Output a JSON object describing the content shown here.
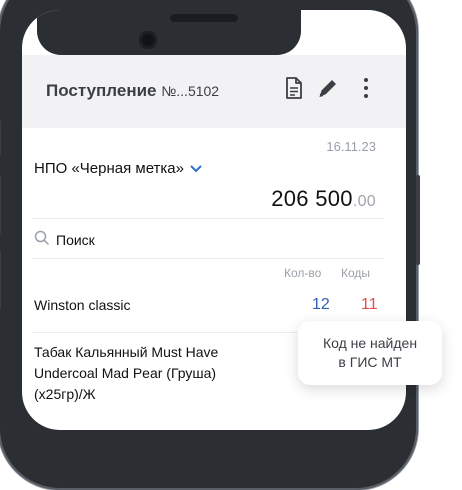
{
  "header": {
    "title": "Поступление",
    "number": "№...5102",
    "icons": [
      "document-icon",
      "pencil-icon",
      "more-vertical-icon"
    ]
  },
  "document": {
    "date": "16.11.23",
    "supplier": "НПО «Черная метка»",
    "amount_main": "206 500",
    "amount_cents": ".00"
  },
  "search": {
    "label": "Поиск"
  },
  "table": {
    "columns": [
      "Кол-во",
      "Коды"
    ],
    "rows": [
      {
        "name": "Winston classic",
        "qty": "12",
        "codes": "11"
      },
      {
        "name_lines": [
          "Табак Кальянный Must Have",
          "Undercoal Mad Pear (Груша)",
          "(x25гр)/Ж"
        ]
      }
    ]
  },
  "tooltip": {
    "line1": "Код не найден",
    "line2": "в ГИС МТ"
  },
  "colors": {
    "accent": "#2f6fd1",
    "qty": "#2f5fb8",
    "codes_error": "#e24c4c",
    "header_bg": "#f2f2f4"
  }
}
